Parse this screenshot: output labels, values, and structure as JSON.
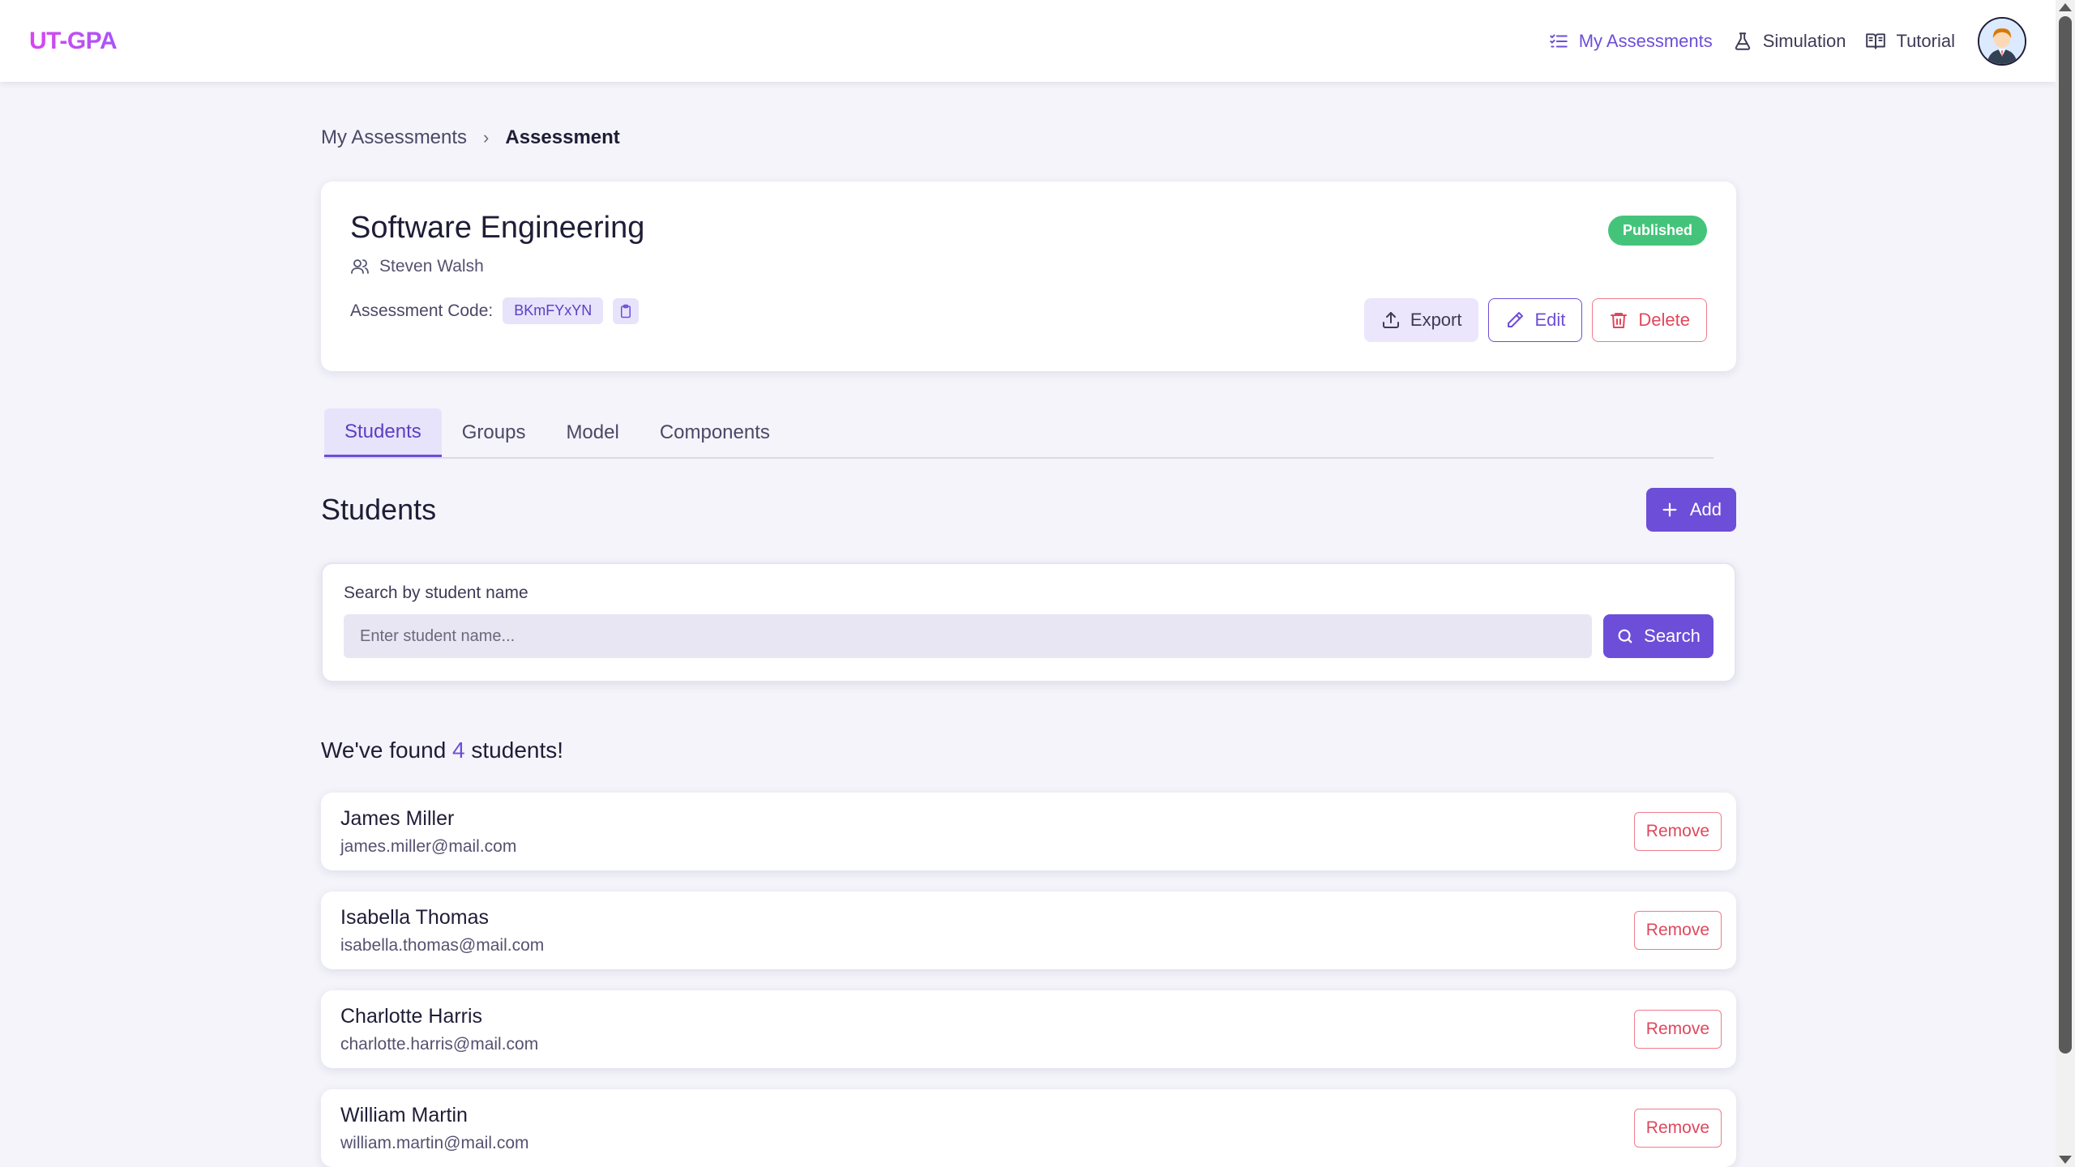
{
  "app": {
    "logo": "UT-GPA"
  },
  "nav": {
    "items": [
      {
        "label": "My Assessments",
        "icon": "checklist-icon",
        "active": true
      },
      {
        "label": "Simulation",
        "icon": "flask-icon",
        "active": false
      },
      {
        "label": "Tutorial",
        "icon": "book-icon",
        "active": false
      }
    ]
  },
  "breadcrumb": {
    "parent": "My Assessments",
    "current": "Assessment"
  },
  "assessment": {
    "title": "Software Engineering",
    "owner": "Steven Walsh",
    "code_label": "Assessment Code:",
    "code": "BKmFYxYN",
    "status": "Published",
    "status_color": "#44c47a",
    "actions": {
      "export": "Export",
      "edit": "Edit",
      "delete": "Delete"
    }
  },
  "tabs": [
    {
      "label": "Students",
      "active": true
    },
    {
      "label": "Groups",
      "active": false
    },
    {
      "label": "Model",
      "active": false
    },
    {
      "label": "Components",
      "active": false
    }
  ],
  "students_section": {
    "title": "Students",
    "add_label": "Add",
    "search": {
      "label": "Search by student name",
      "placeholder": "Enter student name...",
      "button": "Search"
    },
    "found_prefix": "We've found",
    "found_count": "4",
    "found_suffix": "students!",
    "remove_label": "Remove",
    "students": [
      {
        "name": "James Miller",
        "email": "james.miller@mail.com"
      },
      {
        "name": "Isabella Thomas",
        "email": "isabella.thomas@mail.com"
      },
      {
        "name": "Charlotte Harris",
        "email": "charlotte.harris@mail.com"
      },
      {
        "name": "William Martin",
        "email": "william.martin@mail.com"
      }
    ]
  },
  "colors": {
    "accent": "#6d4ed8",
    "danger": "#e0475c"
  }
}
